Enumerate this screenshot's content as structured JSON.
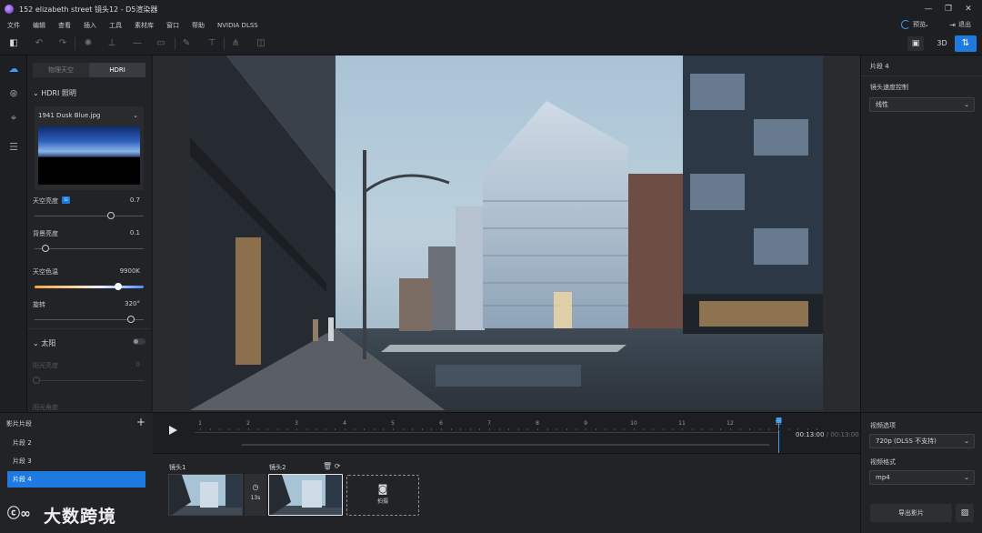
{
  "window": {
    "title": "152 elizabeth street 镜头12 - D5渲染器",
    "controls": [
      "—",
      "❐",
      "✕"
    ]
  },
  "menu": {
    "items": [
      "文件",
      "编辑",
      "查看",
      "插入",
      "工具",
      "素材库",
      "窗口",
      "帮助",
      "NVIDIA DLSS"
    ],
    "preview_label": "预览",
    "exit_label": "退出"
  },
  "view_toggle": {
    "render_icon": "image-icon",
    "mode_3d": "3D",
    "swap_icon": "swap-icon"
  },
  "left_panel": {
    "segment": {
      "physical": "物理天空",
      "hdri": "HDRI"
    },
    "hdri_section": "HDRI 照明",
    "hdri_file": "1941 Dusk Blue.jpg",
    "sky_brightness": {
      "label": "天空亮度",
      "value": "0.7",
      "fraction": 0.7
    },
    "bg_brightness": {
      "label": "背景亮度",
      "value": "0.1",
      "fraction": 0.1
    },
    "sky_color": {
      "label": "天空色温",
      "value": "9900K",
      "fraction": 0.77
    },
    "rotation": {
      "label": "旋转",
      "value": "320°",
      "fraction": 0.88
    },
    "sun_section": "太阳",
    "sun_brightness": {
      "label": "阳光亮度",
      "value": "0"
    },
    "sun_angle": {
      "label": "阳光角度"
    }
  },
  "right_panel": {
    "clip_title": "片段 4",
    "speed_label": "镜头速度控制",
    "speed_value": "线性"
  },
  "clips": {
    "header": "影片片段",
    "add_icon": "+",
    "items": [
      "片段 2",
      "片段 3",
      "片段 4"
    ],
    "active_index": 2
  },
  "timeline": {
    "ticks": [
      "1",
      "2",
      "3",
      "4",
      "5",
      "6",
      "7",
      "8",
      "9",
      "10",
      "11",
      "12",
      "13"
    ],
    "current": "00:13:00",
    "total": "/ 00:13:00",
    "playhead_seconds": 13
  },
  "shots": {
    "shot1": "镜头1",
    "shot2": "镜头2",
    "duration": "13s",
    "capture_label": "拍摄"
  },
  "output": {
    "video_label": "视频选项",
    "video_value": "720p (DLSS 不支持)",
    "format_label": "视频格式",
    "format_value": "mp4",
    "export_label": "导出影片"
  },
  "watermark": {
    "text": "大数跨境"
  }
}
